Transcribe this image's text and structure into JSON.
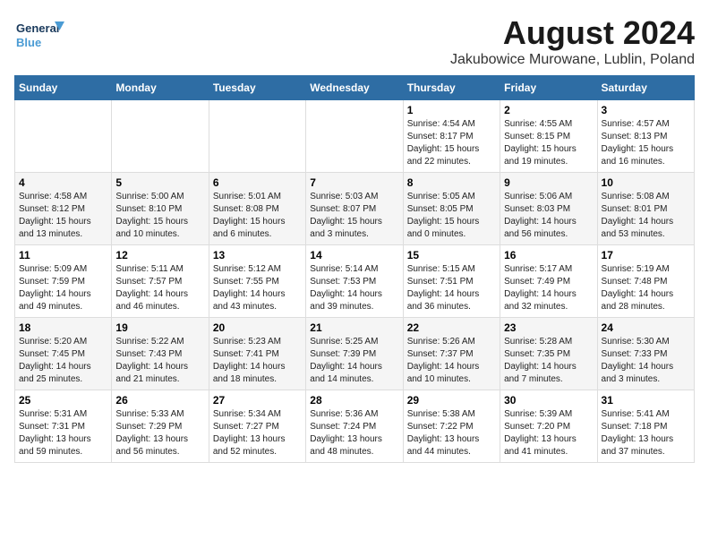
{
  "logo": {
    "line1": "General",
    "line2": "Blue"
  },
  "title": "August 2024",
  "subtitle": "Jakubowice Murowane, Lublin, Poland",
  "weekdays": [
    "Sunday",
    "Monday",
    "Tuesday",
    "Wednesday",
    "Thursday",
    "Friday",
    "Saturday"
  ],
  "weeks": [
    [
      {
        "day": "",
        "info": ""
      },
      {
        "day": "",
        "info": ""
      },
      {
        "day": "",
        "info": ""
      },
      {
        "day": "",
        "info": ""
      },
      {
        "day": "1",
        "info": "Sunrise: 4:54 AM\nSunset: 8:17 PM\nDaylight: 15 hours\nand 22 minutes."
      },
      {
        "day": "2",
        "info": "Sunrise: 4:55 AM\nSunset: 8:15 PM\nDaylight: 15 hours\nand 19 minutes."
      },
      {
        "day": "3",
        "info": "Sunrise: 4:57 AM\nSunset: 8:13 PM\nDaylight: 15 hours\nand 16 minutes."
      }
    ],
    [
      {
        "day": "4",
        "info": "Sunrise: 4:58 AM\nSunset: 8:12 PM\nDaylight: 15 hours\nand 13 minutes."
      },
      {
        "day": "5",
        "info": "Sunrise: 5:00 AM\nSunset: 8:10 PM\nDaylight: 15 hours\nand 10 minutes."
      },
      {
        "day": "6",
        "info": "Sunrise: 5:01 AM\nSunset: 8:08 PM\nDaylight: 15 hours\nand 6 minutes."
      },
      {
        "day": "7",
        "info": "Sunrise: 5:03 AM\nSunset: 8:07 PM\nDaylight: 15 hours\nand 3 minutes."
      },
      {
        "day": "8",
        "info": "Sunrise: 5:05 AM\nSunset: 8:05 PM\nDaylight: 15 hours\nand 0 minutes."
      },
      {
        "day": "9",
        "info": "Sunrise: 5:06 AM\nSunset: 8:03 PM\nDaylight: 14 hours\nand 56 minutes."
      },
      {
        "day": "10",
        "info": "Sunrise: 5:08 AM\nSunset: 8:01 PM\nDaylight: 14 hours\nand 53 minutes."
      }
    ],
    [
      {
        "day": "11",
        "info": "Sunrise: 5:09 AM\nSunset: 7:59 PM\nDaylight: 14 hours\nand 49 minutes."
      },
      {
        "day": "12",
        "info": "Sunrise: 5:11 AM\nSunset: 7:57 PM\nDaylight: 14 hours\nand 46 minutes."
      },
      {
        "day": "13",
        "info": "Sunrise: 5:12 AM\nSunset: 7:55 PM\nDaylight: 14 hours\nand 43 minutes."
      },
      {
        "day": "14",
        "info": "Sunrise: 5:14 AM\nSunset: 7:53 PM\nDaylight: 14 hours\nand 39 minutes."
      },
      {
        "day": "15",
        "info": "Sunrise: 5:15 AM\nSunset: 7:51 PM\nDaylight: 14 hours\nand 36 minutes."
      },
      {
        "day": "16",
        "info": "Sunrise: 5:17 AM\nSunset: 7:49 PM\nDaylight: 14 hours\nand 32 minutes."
      },
      {
        "day": "17",
        "info": "Sunrise: 5:19 AM\nSunset: 7:48 PM\nDaylight: 14 hours\nand 28 minutes."
      }
    ],
    [
      {
        "day": "18",
        "info": "Sunrise: 5:20 AM\nSunset: 7:45 PM\nDaylight: 14 hours\nand 25 minutes."
      },
      {
        "day": "19",
        "info": "Sunrise: 5:22 AM\nSunset: 7:43 PM\nDaylight: 14 hours\nand 21 minutes."
      },
      {
        "day": "20",
        "info": "Sunrise: 5:23 AM\nSunset: 7:41 PM\nDaylight: 14 hours\nand 18 minutes."
      },
      {
        "day": "21",
        "info": "Sunrise: 5:25 AM\nSunset: 7:39 PM\nDaylight: 14 hours\nand 14 minutes."
      },
      {
        "day": "22",
        "info": "Sunrise: 5:26 AM\nSunset: 7:37 PM\nDaylight: 14 hours\nand 10 minutes."
      },
      {
        "day": "23",
        "info": "Sunrise: 5:28 AM\nSunset: 7:35 PM\nDaylight: 14 hours\nand 7 minutes."
      },
      {
        "day": "24",
        "info": "Sunrise: 5:30 AM\nSunset: 7:33 PM\nDaylight: 14 hours\nand 3 minutes."
      }
    ],
    [
      {
        "day": "25",
        "info": "Sunrise: 5:31 AM\nSunset: 7:31 PM\nDaylight: 13 hours\nand 59 minutes."
      },
      {
        "day": "26",
        "info": "Sunrise: 5:33 AM\nSunset: 7:29 PM\nDaylight: 13 hours\nand 56 minutes."
      },
      {
        "day": "27",
        "info": "Sunrise: 5:34 AM\nSunset: 7:27 PM\nDaylight: 13 hours\nand 52 minutes."
      },
      {
        "day": "28",
        "info": "Sunrise: 5:36 AM\nSunset: 7:24 PM\nDaylight: 13 hours\nand 48 minutes."
      },
      {
        "day": "29",
        "info": "Sunrise: 5:38 AM\nSunset: 7:22 PM\nDaylight: 13 hours\nand 44 minutes."
      },
      {
        "day": "30",
        "info": "Sunrise: 5:39 AM\nSunset: 7:20 PM\nDaylight: 13 hours\nand 41 minutes."
      },
      {
        "day": "31",
        "info": "Sunrise: 5:41 AM\nSunset: 7:18 PM\nDaylight: 13 hours\nand 37 minutes."
      }
    ]
  ]
}
